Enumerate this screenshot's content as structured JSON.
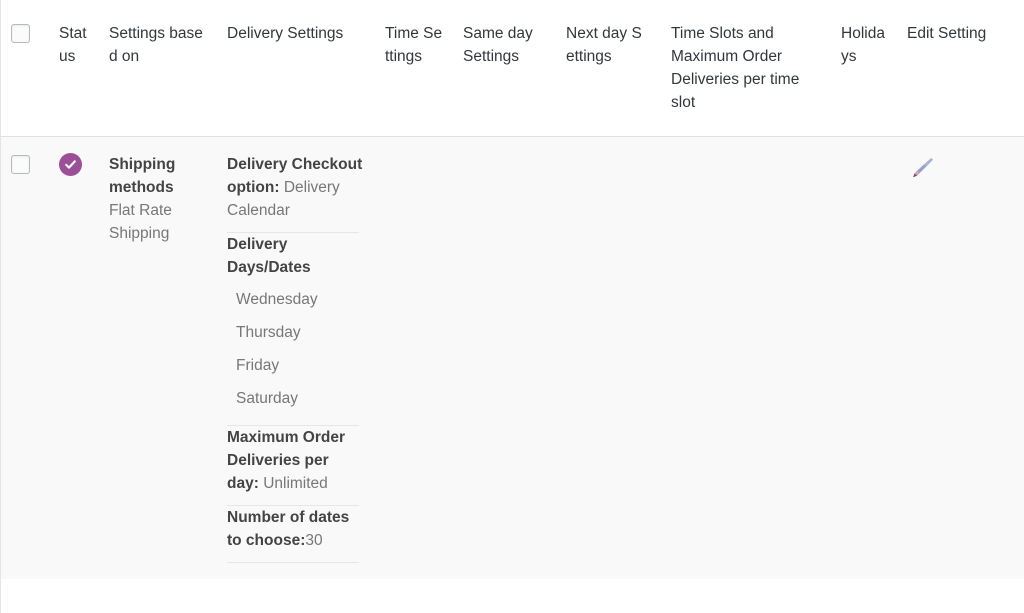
{
  "table": {
    "headers": [
      {
        "key": "select-all",
        "label": ""
      },
      {
        "key": "status",
        "label": "Status"
      },
      {
        "key": "settings-based-on",
        "label": "Settings based on"
      },
      {
        "key": "delivery-settings",
        "label": "Delivery Settings"
      },
      {
        "key": "time-settings",
        "label": "Time Settings"
      },
      {
        "key": "same-day-settings",
        "label": "Same day Settings"
      },
      {
        "key": "next-day-settings",
        "label": "Next day Settings"
      },
      {
        "key": "time-slots",
        "label": "Time Slots and Maximum Order Deliveries per time slot"
      },
      {
        "key": "holidays",
        "label": "Holidays"
      },
      {
        "key": "edit-setting",
        "label": "Edit Setting"
      }
    ],
    "row": {
      "status": {
        "icon": "check-circle-icon",
        "color": "#9b4f96",
        "state": "enabled"
      },
      "settings_based_on": {
        "title": "Shipping methods",
        "value": "Flat Rate Shipping"
      },
      "delivery_settings": {
        "checkout_option": {
          "title": "Delivery Checkout option",
          "separator": ": ",
          "value": "Delivery Calendar"
        },
        "delivery_days": {
          "title": "Delivery Days/Dates",
          "days": [
            "Wednesday",
            "Thursday",
            "Friday",
            "Saturday"
          ]
        },
        "max_order_deliveries": {
          "title": "Maximum Order Deliveries per day",
          "separator": ": ",
          "value": "Unlimited"
        },
        "number_of_dates": {
          "title": "Number of dates to choose",
          "separator": ":",
          "value": "30"
        }
      },
      "time_settings": "",
      "same_day_settings": "",
      "next_day_settings": "",
      "time_slots": "",
      "holidays": "",
      "edit": {
        "icon": "pencil-icon",
        "label": "Edit Setting"
      }
    }
  },
  "colors": {
    "status_purple": "#9b4f96",
    "header_bg": "#ffffff",
    "row_bg": "#f9f9f9",
    "border": "#e1e1e1",
    "text_dark": "#444444",
    "text_muted": "#777777"
  }
}
